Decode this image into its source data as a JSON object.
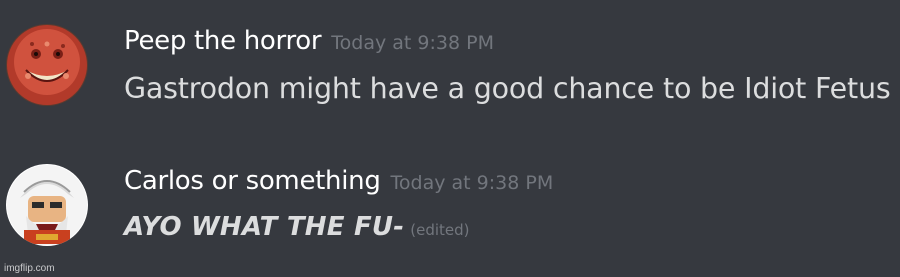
{
  "messages": [
    {
      "username": "Peep the horror",
      "timestamp": "Today at 9:38 PM",
      "content": "Gastrodon might have a good chance to be Idiot Fetus",
      "avatar_icon": "red-grinning-face-avatar"
    },
    {
      "username": "Carlos or something",
      "timestamp": "Today at 9:38 PM",
      "content": "AYO WHAT THE FU-",
      "edited_label": "(edited)",
      "avatar_icon": "white-haired-bearded-man-avatar"
    }
  ],
  "watermark": "imgflip.com",
  "colors": {
    "background": "#36393f",
    "username": "#ffffff",
    "timestamp": "#72767d",
    "message_text": "#dcddde"
  }
}
